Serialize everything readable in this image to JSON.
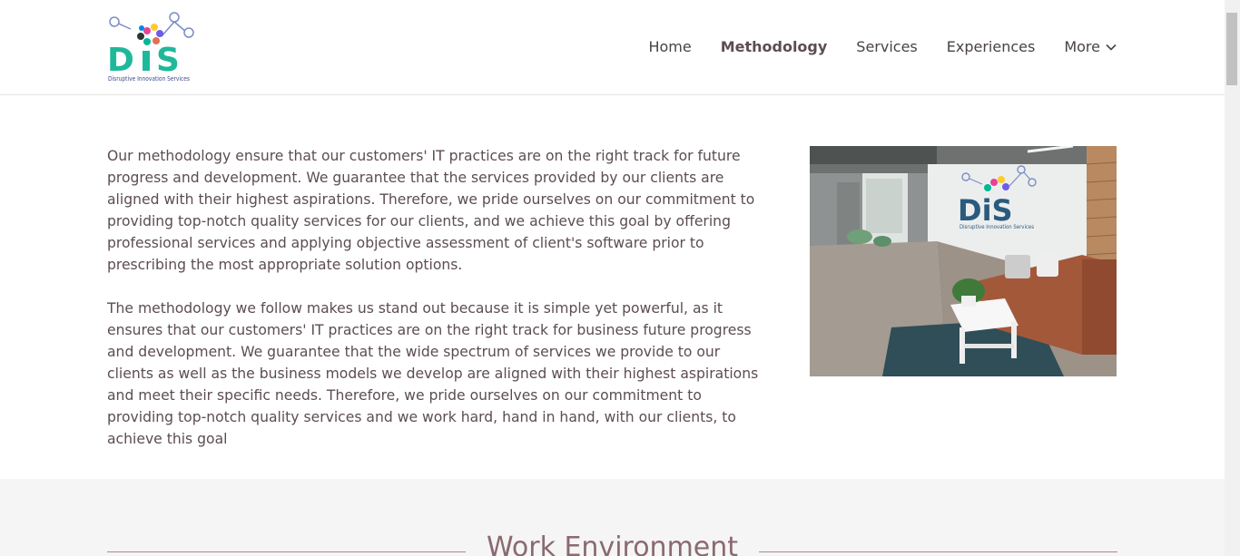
{
  "header": {
    "logo_text": "Disruptive Innovation Services",
    "logo_letters": "DiS",
    "nav": [
      {
        "label": "Home",
        "active": false
      },
      {
        "label": "Methodology",
        "active": true
      },
      {
        "label": "Services",
        "active": false
      },
      {
        "label": "Experiences",
        "active": false
      },
      {
        "label": "More",
        "active": false,
        "icon": "chevron-down-icon"
      }
    ]
  },
  "main": {
    "paragraphs": [
      "Our methodology ensure that our customers' IT practices are on the right track for future progress and development. We guarantee that the services provided by our clients are aligned with their highest aspirations. Therefore, we pride ourselves on our commitment to providing top-notch quality services for our clients, and we achieve this goal by offering professional services and applying objective assessment of client's software prior to prescribing the most appropriate solution options.",
      "The methodology we follow makes us stand out because it is simple yet powerful, as it ensures that our customers' IT practices are on the right track for business future progress and development. We guarantee that the wide spectrum of services we provide to our clients as well as the business models we develop are aligned with their highest aspirations and meet their specific needs. Therefore, we pride ourselves on our commitment to providing top-notch quality services and we work hard, hand in hand, with our clients, to achieve this goal"
    ],
    "photo_logo_letters": "DiS",
    "photo_logo_text": "Disruptive Innovation Services"
  },
  "work_section": {
    "title": "Work Environment"
  },
  "colors": {
    "accent": "#8a6a70",
    "logo_teal": "#1fb89a",
    "text": "#5c4d52"
  }
}
